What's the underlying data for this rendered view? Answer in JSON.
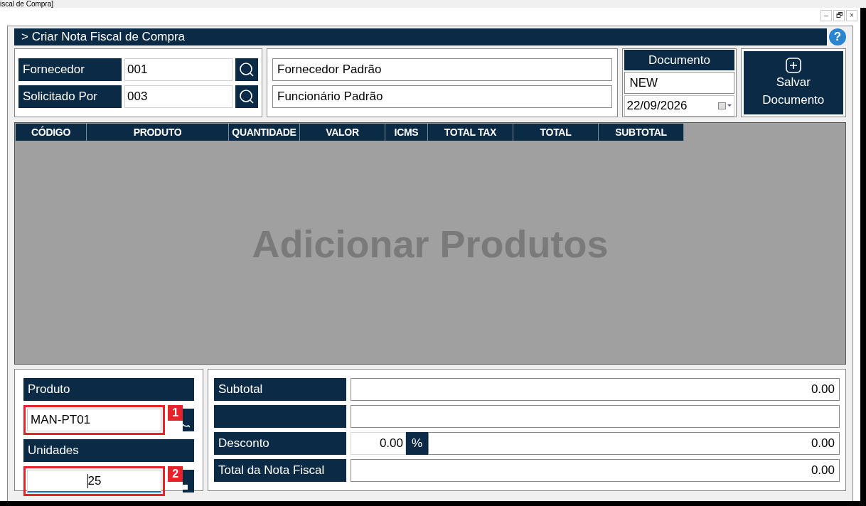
{
  "window": {
    "title": "iscal de Compra]",
    "controls": [
      "–",
      "🗗",
      "×"
    ]
  },
  "header": {
    "title": "> Criar Nota Fiscal de Compra",
    "help": "?"
  },
  "lookups": [
    {
      "label": "Fornecedor",
      "code": "001",
      "name": "Fornecedor Padrão"
    },
    {
      "label": "Solicitado Por",
      "code": "003",
      "name": "Funcionário Padrão"
    }
  ],
  "document": {
    "title": "Documento",
    "number": "NEW",
    "date": "22/09/2026"
  },
  "save_button": {
    "label_lines": [
      "Salvar",
      "Documento"
    ]
  },
  "table": {
    "columns": [
      "CÓDIGO",
      "PRODUTO",
      "QUANTIDADE",
      "VALOR",
      "ICMS",
      "TOTAL TAX",
      "TOTAL",
      "SUBTOTAL"
    ],
    "empty_text": "Adicionar Produtos"
  },
  "entry": [
    {
      "label": "Produto",
      "value": "MAN-PT01",
      "focused": false,
      "kind": "lookup",
      "callout": "1"
    },
    {
      "label": "Unidades",
      "value": "25",
      "focused": true,
      "kind": "quantity",
      "callout": "2"
    }
  ],
  "totals": [
    {
      "kind": "plain",
      "label": "Subtotal",
      "value": "0.00"
    },
    {
      "kind": "plain"
    },
    {
      "kind": "discount",
      "label": "Desconto",
      "amount": "0.00",
      "unit": "%",
      "value": "0.00"
    },
    {
      "kind": "plain",
      "label": "Total da Nota Fiscal",
      "value": "0.00"
    }
  ]
}
